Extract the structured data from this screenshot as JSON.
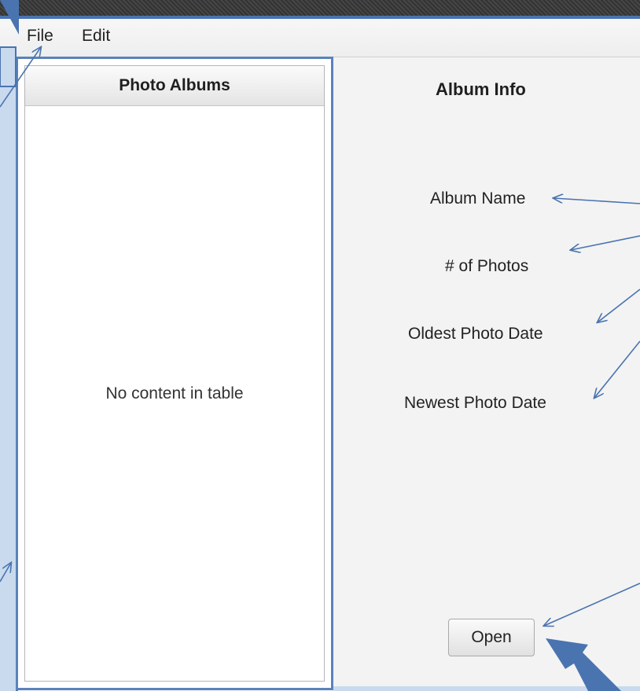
{
  "menu": {
    "file": "File",
    "edit": "Edit"
  },
  "albums_table": {
    "header": "Photo Albums",
    "empty_message": "No content in table"
  },
  "album_info": {
    "title": "Album Info",
    "album_name": "Album Name",
    "photo_count": "# of Photos",
    "oldest_date": "Oldest Photo Date",
    "newest_date": "Newest Photo Date",
    "open_button": "Open"
  },
  "colors": {
    "annotation_blue": "#4a74b0",
    "annotation_fill": "#c9daee"
  }
}
